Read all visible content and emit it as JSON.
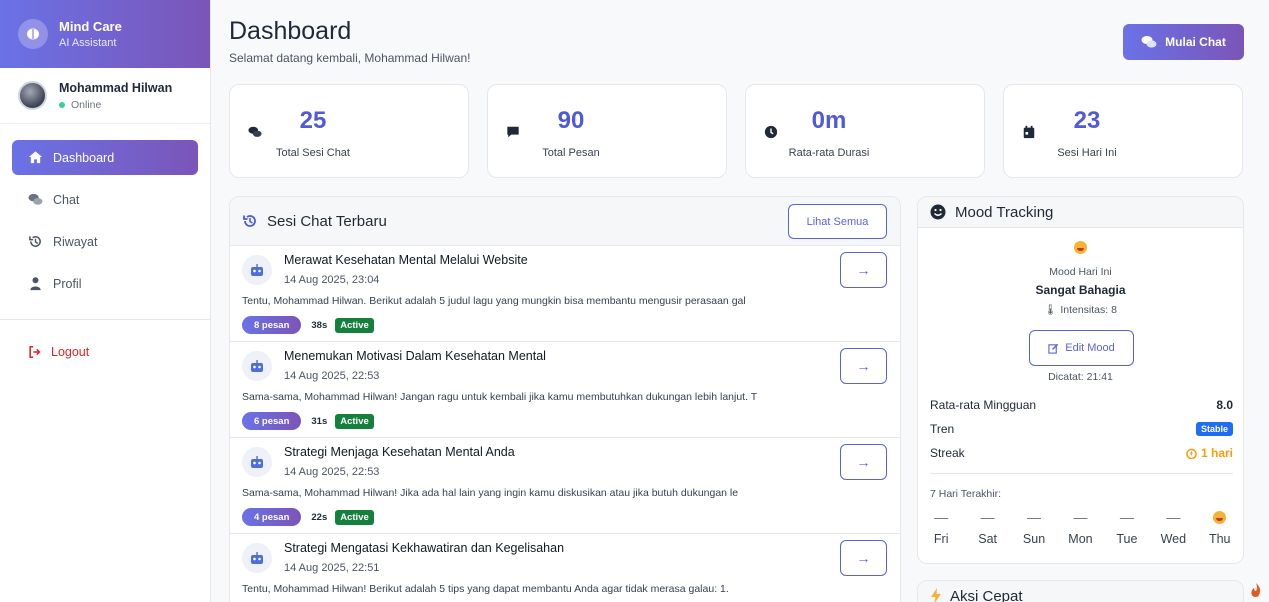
{
  "brand": {
    "title": "Mind Care",
    "subtitle": "AI Assistant"
  },
  "user": {
    "name": "Mohammad Hilwan",
    "status": "Online"
  },
  "nav": [
    {
      "label": "Dashboard",
      "icon": "home-icon",
      "active": true
    },
    {
      "label": "Chat",
      "icon": "chat-icon"
    },
    {
      "label": "Riwayat",
      "icon": "history-icon"
    },
    {
      "label": "Profil",
      "icon": "user-icon"
    }
  ],
  "logout": "Logout",
  "header": {
    "title": "Dashboard",
    "subtitle": "Selamat datang kembali, Mohammad Hilwan!",
    "start_chat": "Mulai Chat"
  },
  "stats": [
    {
      "value": "25",
      "label": "Total Sesi Chat",
      "icon": "comments-icon"
    },
    {
      "value": "90",
      "label": "Total Pesan",
      "icon": "message-icon"
    },
    {
      "value": "0m",
      "label": "Rata-rata Durasi",
      "icon": "clock-icon"
    },
    {
      "value": "23",
      "label": "Sesi Hari Ini",
      "icon": "calendar-icon"
    }
  ],
  "sessions": {
    "title": "Sesi Chat Terbaru",
    "view_all": "Lihat Semua",
    "items": [
      {
        "title": "Merawat Kesehatan Mental Melalui Website",
        "time": "14 Aug 2025, 23:04",
        "preview": "Tentu, Mohammad Hilwan. Berikut adalah 5 judul lagu yang mungkin bisa membantu mengusir perasaan gal",
        "messages": "8 pesan",
        "duration": "38s",
        "status": "Active"
      },
      {
        "title": "Menemukan Motivasi Dalam Kesehatan Mental",
        "time": "14 Aug 2025, 22:53",
        "preview": "Sama-sama, Mohammad Hilwan! Jangan ragu untuk kembali jika kamu membutuhkan dukungan lebih lanjut. T",
        "messages": "6 pesan",
        "duration": "31s",
        "status": "Active"
      },
      {
        "title": "Strategi Menjaga Kesehatan Mental Anda",
        "time": "14 Aug 2025, 22:53",
        "preview": "Sama-sama, Mohammad Hilwan! Jika ada hal lain yang ingin kamu diskusikan atau jika butuh dukungan le",
        "messages": "4 pesan",
        "duration": "22s",
        "status": "Active"
      },
      {
        "title": "Strategi Mengatasi Kekhawatiran dan Kegelisahan",
        "time": "14 Aug 2025, 22:51",
        "preview": "Tentu, Mohammad Hilwan! Berikut adalah 5 tips yang dapat membantu Anda agar tidak merasa galau: 1.",
        "messages": "",
        "duration": "",
        "status": ""
      }
    ]
  },
  "mood": {
    "title": "Mood Tracking",
    "today_label": "Mood Hari Ini",
    "today_value": "Sangat Bahagia",
    "intensity": "Intensitas: 8",
    "edit": "Edit Mood",
    "recorded": "Dicatat: 21:41",
    "weekly_avg_label": "Rata-rata Mingguan",
    "weekly_avg_value": "8.0",
    "trend_label": "Tren",
    "trend_value": "Stable",
    "streak_label": "Streak",
    "streak_value": "1 hari",
    "last7_label": "7 Hari Terakhir:",
    "days": [
      {
        "label": "Fri",
        "mark": "—"
      },
      {
        "label": "Sat",
        "mark": "—"
      },
      {
        "label": "Sun",
        "mark": "—"
      },
      {
        "label": "Mon",
        "mark": "—"
      },
      {
        "label": "Tue",
        "mark": "—"
      },
      {
        "label": "Wed",
        "mark": "—"
      },
      {
        "label": "Thu",
        "mark": ""
      }
    ]
  },
  "quick_actions": {
    "title": "Aksi Cepat"
  },
  "colors": {
    "accent": "#5863d6",
    "gradient_start": "#6a72e6",
    "gradient_end": "#7b55b8",
    "active": "#15803d",
    "stable": "#1d6ef5",
    "streak": "#f59e0b",
    "logout": "#dc2626"
  }
}
